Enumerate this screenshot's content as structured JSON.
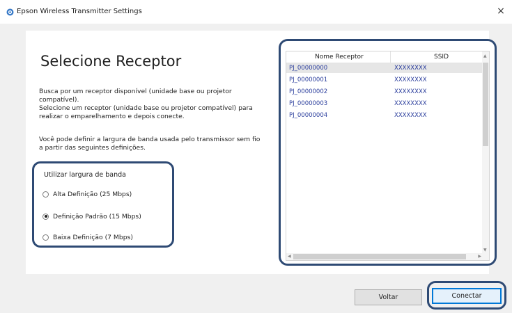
{
  "window": {
    "title": "Epson Wireless Transmitter Settings",
    "close_glyph": "×"
  },
  "main": {
    "heading": "Selecione Receptor",
    "description_1": "Busca por um receptor disponível (unidade base ou projetor compatível).\nSelecione um receptor (unidade base ou projetor compatível) para realizar o emparelhamento e depois conecte.",
    "description_2": "Você pode definir a largura de banda usada pelo transmissor sem fio a partir das seguintes definições."
  },
  "bandwidth": {
    "label": "Utilizar largura de banda",
    "options": [
      {
        "label": "Alta Definição (25 Mbps)",
        "checked": false
      },
      {
        "label": "Definição Padrão (15 Mbps)",
        "checked": true
      },
      {
        "label": "Baixa Definição (7 Mbps)",
        "checked": false
      }
    ]
  },
  "receiver_list": {
    "columns": [
      "Nome Receptor",
      "SSID"
    ],
    "rows": [
      {
        "name": "PJ_00000000",
        "ssid": "XXXXXXXX",
        "selected": true
      },
      {
        "name": "PJ_00000001",
        "ssid": "XXXXXXXX",
        "selected": false
      },
      {
        "name": "PJ_00000002",
        "ssid": "XXXXXXXX",
        "selected": false
      },
      {
        "name": "PJ_00000003",
        "ssid": "XXXXXXXX",
        "selected": false
      },
      {
        "name": "PJ_00000004",
        "ssid": "XXXXXXXX",
        "selected": false
      }
    ],
    "scroll_up_glyph": "▲",
    "scroll_down_glyph": "▼",
    "scroll_left_glyph": "◀",
    "scroll_right_glyph": "▶"
  },
  "buttons": {
    "back": "Voltar",
    "connect": "Conectar"
  },
  "colors": {
    "highlight_frame": "#2e4a74",
    "list_text": "#2a3d9c",
    "focus_accent": "#0078d7"
  },
  "icons": {
    "title_icon": "epson-app-icon",
    "close": "close-icon"
  }
}
